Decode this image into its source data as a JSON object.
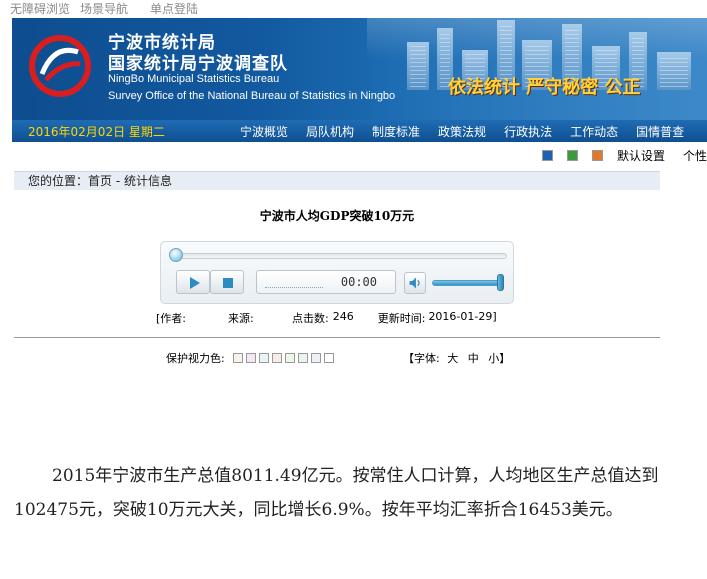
{
  "toplinks": [
    "无障碍浏览",
    "场景导航",
    "单点登陆"
  ],
  "banner": {
    "title_cn_1": "宁波市统计局",
    "title_cn_2": "国家统计局宁波调查队",
    "title_en_1": "NingBo Municipal Statistics Bureau",
    "title_en_2": "Survey Office of the National Bureau of Statistics in Ningbo",
    "slogan": "依法统计  严守秘密  公正"
  },
  "nav": {
    "date": "2016年02月02日 星期二",
    "items": [
      "宁波概览",
      "局队机构",
      "制度标准",
      "政策法规",
      "行政执法",
      "工作动态",
      "国情普查"
    ]
  },
  "style_row": {
    "swatch_colors": [
      "#2060b0",
      "#3c9a3c",
      "#e07a2a"
    ],
    "default_label": "默认设置",
    "personal_label": "个性"
  },
  "breadcrumb": "您的位置：首页 - 统计信息",
  "article": {
    "title": "宁波市人均GDP突破10万元",
    "player_time": "00:00",
    "meta": {
      "author_label": "[作者:",
      "source_label": "来源:",
      "clicks_label": "点击数:",
      "clicks": "246",
      "date_label": "更新时间:",
      "date": "2016-01-29]"
    },
    "eye_label": "保护视力色:",
    "eye_colors": [
      "#f7f1e8",
      "#f4e8f4",
      "#e8f4f8",
      "#f8ece8",
      "#eef6e8",
      "#e8f4ee",
      "#eef0f6",
      "#ffffff"
    ],
    "font_label": "【字体:",
    "font_large": "大",
    "font_medium": "中",
    "font_small": "小】",
    "body": "2015年宁波市生产总值8011.49亿元。按常住人口计算，人均地区生产总值达到102475元，突破10万元大关，同比增长6.9%。按年平均汇率折合16453美元。"
  }
}
